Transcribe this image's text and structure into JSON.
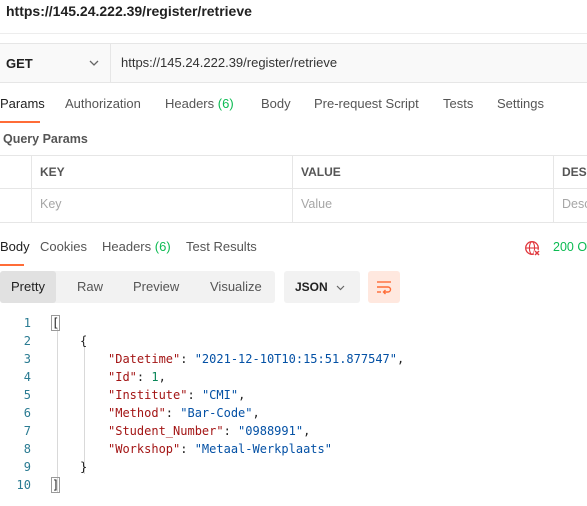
{
  "title": "https://145.24.222.39/register/retrieve",
  "request": {
    "method": "GET",
    "url": "https://145.24.222.39/register/retrieve"
  },
  "request_tabs": [
    {
      "label": "Params"
    },
    {
      "label": "Authorization"
    },
    {
      "label": "Headers",
      "count": "(6)"
    },
    {
      "label": "Body"
    },
    {
      "label": "Pre-request Script"
    },
    {
      "label": "Tests"
    },
    {
      "label": "Settings"
    }
  ],
  "query_params": {
    "title": "Query Params",
    "columns": [
      "KEY",
      "VALUE",
      "DESC"
    ],
    "placeholders": [
      "Key",
      "Value",
      "Desc"
    ]
  },
  "response_tabs": [
    {
      "label": "Body"
    },
    {
      "label": "Cookies"
    },
    {
      "label": "Headers",
      "count": "(6)"
    },
    {
      "label": "Test Results"
    }
  ],
  "status": "200 O",
  "view_modes": [
    "Pretty",
    "Raw",
    "Preview",
    "Visualize"
  ],
  "language": "JSON",
  "code_lines": [
    {
      "n": "1",
      "tokens": [
        {
          "t": "[",
          "c": "punct",
          "box": true
        }
      ]
    },
    {
      "n": "2",
      "tokens": [
        {
          "t": "{",
          "c": "punct"
        }
      ]
    },
    {
      "n": "3",
      "tokens": [
        {
          "t": "\"Datetime\"",
          "c": "key"
        },
        {
          "t": ": ",
          "c": "punct"
        },
        {
          "t": "\"2021-12-10T10:15:51.877547\"",
          "c": "str"
        },
        {
          "t": ",",
          "c": "punct"
        }
      ]
    },
    {
      "n": "4",
      "tokens": [
        {
          "t": "\"Id\"",
          "c": "key"
        },
        {
          "t": ": ",
          "c": "punct"
        },
        {
          "t": "1",
          "c": "num"
        },
        {
          "t": ",",
          "c": "punct"
        }
      ]
    },
    {
      "n": "5",
      "tokens": [
        {
          "t": "\"Institute\"",
          "c": "key"
        },
        {
          "t": ": ",
          "c": "punct"
        },
        {
          "t": "\"CMI\"",
          "c": "str"
        },
        {
          "t": ",",
          "c": "punct"
        }
      ]
    },
    {
      "n": "6",
      "tokens": [
        {
          "t": "\"Method\"",
          "c": "key"
        },
        {
          "t": ": ",
          "c": "punct"
        },
        {
          "t": "\"Bar-Code\"",
          "c": "str"
        },
        {
          "t": ",",
          "c": "punct"
        }
      ]
    },
    {
      "n": "7",
      "tokens": [
        {
          "t": "\"Student_Number\"",
          "c": "key"
        },
        {
          "t": ": ",
          "c": "punct"
        },
        {
          "t": "\"0988991\"",
          "c": "str"
        },
        {
          "t": ",",
          "c": "punct"
        }
      ]
    },
    {
      "n": "8",
      "tokens": [
        {
          "t": "\"Workshop\"",
          "c": "key"
        },
        {
          "t": ": ",
          "c": "punct"
        },
        {
          "t": "\"Metaal-Werkplaats\"",
          "c": "str"
        }
      ]
    },
    {
      "n": "9",
      "tokens": [
        {
          "t": "}",
          "c": "punct"
        }
      ]
    },
    {
      "n": "10",
      "tokens": [
        {
          "t": "]",
          "c": "punct",
          "box": true
        }
      ]
    }
  ],
  "colors": {
    "accent": "#ff6c37",
    "success": "#0cbb52",
    "json_key": "#a31515",
    "json_string": "#0451a5",
    "json_number": "#098658"
  },
  "icons": {
    "method_dropdown": "chevron-down-icon",
    "status": "globe-error-icon",
    "wrap": "wrap-lines-icon"
  }
}
